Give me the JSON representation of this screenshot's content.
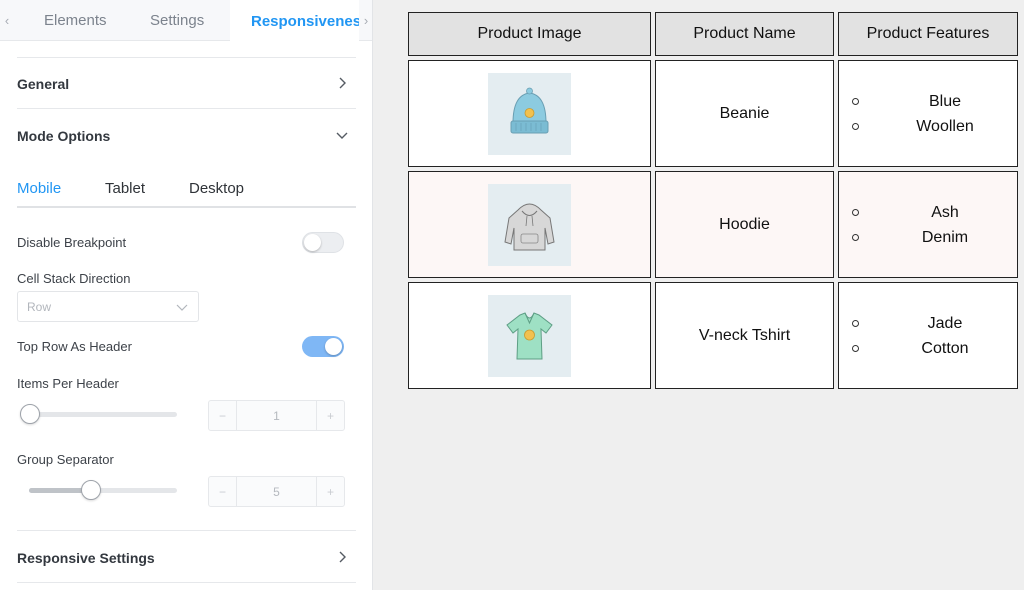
{
  "panel": {
    "tabs": [
      {
        "label": "Elements"
      },
      {
        "label": "Settings"
      },
      {
        "label": "Responsivenes"
      }
    ],
    "sections": {
      "general": "General",
      "mode_options": "Mode Options",
      "responsive_settings": "Responsive Settings"
    },
    "mode_tabs": [
      {
        "label": "Mobile",
        "active": true
      },
      {
        "label": "Tablet",
        "active": false
      },
      {
        "label": "Desktop",
        "active": false
      }
    ],
    "disable_breakpoint": {
      "label": "Disable Breakpoint",
      "on": false
    },
    "cell_stack_direction": {
      "label": "Cell Stack Direction",
      "value": "Row"
    },
    "top_row_as_header": {
      "label": "Top Row As Header",
      "on": true
    },
    "items_per_header": {
      "label": "Items Per Header",
      "value": "1",
      "level": 0
    },
    "group_separator": {
      "label": "Group Separator",
      "value": "5",
      "level": 0.44
    }
  },
  "table": {
    "headers": [
      "Product Image",
      "Product Name",
      "Product Features"
    ],
    "rows": [
      {
        "image": "beanie-image",
        "name": "Beanie",
        "features": [
          "Blue",
          "Woollen"
        ]
      },
      {
        "image": "hoodie-image",
        "name": "Hoodie",
        "features": [
          "Ash",
          "Denim"
        ]
      },
      {
        "image": "tshirt-image",
        "name": "V-neck Tshirt",
        "features": [
          "Jade",
          "Cotton"
        ]
      }
    ]
  },
  "colors": {
    "accent": "#2196f3",
    "toggle_on": "#7fb7f5",
    "tinted_row": "#fdf7f6",
    "header_bg": "#e2e2e2"
  }
}
